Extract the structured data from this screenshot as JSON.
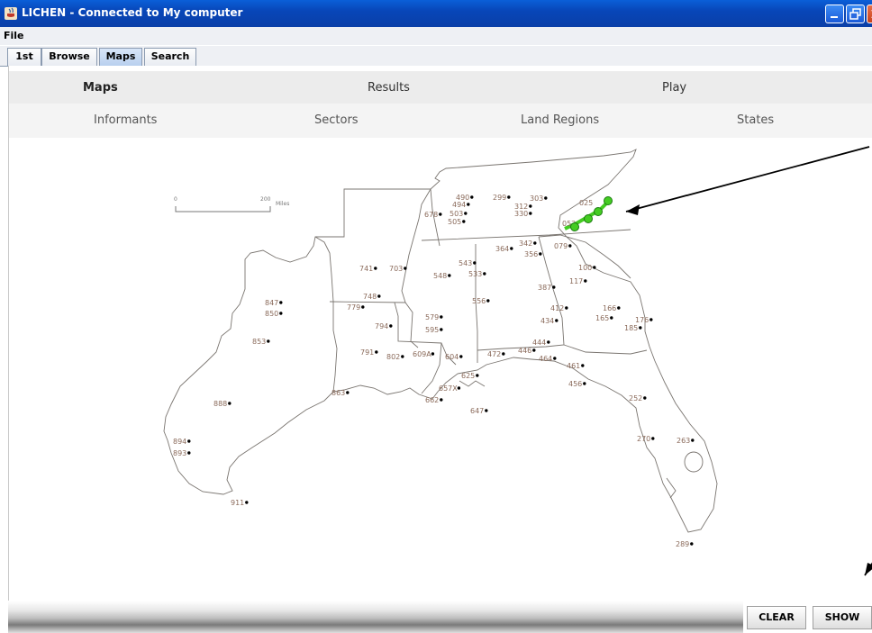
{
  "window": {
    "title": "LICHEN - Connected to My computer"
  },
  "menu": {
    "file": "File"
  },
  "tabs": [
    {
      "label": "1st"
    },
    {
      "label": "Browse"
    },
    {
      "label": "Maps"
    },
    {
      "label": "Search"
    }
  ],
  "nav": {
    "row1": [
      "Maps",
      "Results",
      "Play"
    ],
    "row2": [
      "Informants",
      "Sectors",
      "Land Regions",
      "States"
    ]
  },
  "map": {
    "scale": {
      "start": "0",
      "end": "200",
      "unit": "Miles"
    },
    "points": [
      "490",
      "494",
      "299",
      "303",
      "312",
      "330",
      "678",
      "503",
      "505",
      "025",
      "052",
      "364",
      "342",
      "356",
      "079",
      "543",
      "533",
      "548",
      "741",
      "703",
      "100",
      "117",
      "387",
      "748",
      "779",
      "556",
      "412",
      "434",
      "166",
      "165",
      "176",
      "185",
      "847",
      "850",
      "579",
      "595",
      "794",
      "853",
      "444",
      "446",
      "464",
      "472",
      "791",
      "802",
      "609A",
      "604",
      "461",
      "625",
      "456",
      "657X",
      "662",
      "647",
      "863",
      "888",
      "252",
      "270",
      "263",
      "894",
      "893",
      "911",
      "289"
    ],
    "highlight_color": "#44cc22"
  },
  "buttons": {
    "clear": "CLEAR",
    "show": "SHOW"
  }
}
